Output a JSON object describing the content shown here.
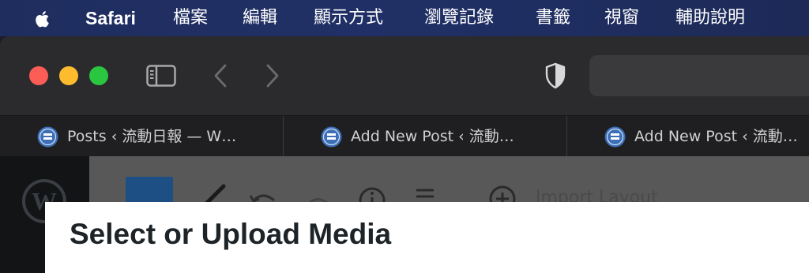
{
  "menubar": {
    "apple_icon": "apple-logo-icon",
    "app_name": "Safari",
    "items": [
      "檔案",
      "編輯",
      "顯示方式",
      "瀏覽記錄",
      "書籤",
      "視窗",
      "輔助說明"
    ]
  },
  "toolbar": {
    "icons": [
      "sidebar-icon",
      "back-chevron-icon",
      "forward-chevron-icon",
      "privacy-shield-icon"
    ]
  },
  "tabs": [
    {
      "title": "Posts ‹ 流動日報 — W…",
      "favicon": "site-favicon-icon"
    },
    {
      "title": "Add New Post ‹ 流動…",
      "favicon": "site-favicon-icon"
    },
    {
      "title": "Add New Post ‹ 流動…",
      "favicon": "site-favicon-icon"
    }
  ],
  "editor": {
    "import_label": "Import Layout"
  },
  "modal": {
    "title": "Select or Upload Media"
  },
  "colors": {
    "menubar": "#1f2d5e",
    "window_chrome": "#2b2b2d",
    "tabbar": "#1f1f21",
    "close": "#fd5d57",
    "minimize": "#fdbc2e",
    "maximize": "#2ac640",
    "wp_blue": "#1d4f85",
    "modal_bg": "#ffffff",
    "modal_title": "#1d2327"
  }
}
